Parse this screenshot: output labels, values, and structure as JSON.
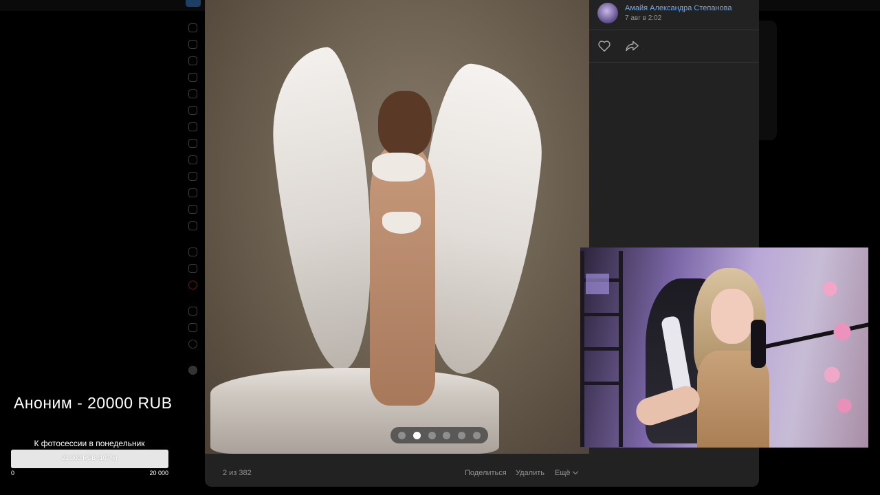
{
  "post": {
    "author_name": "Амайя Александра Степанова",
    "date": "7 авг в 2:02"
  },
  "viewer": {
    "counter": "2 из 382",
    "actions": {
      "share": "Поделиться",
      "delete": "Удалить",
      "more": "Ещё"
    },
    "carousel": {
      "count": 6,
      "active_index": 1
    }
  },
  "donation": {
    "message": "Аноним - 20000 RUB"
  },
  "goal": {
    "title": "К фотосессии в понедельник",
    "progress_text": "21 300 RUB (107%)",
    "min_label": "0",
    "max_label": "20 000",
    "progress_fraction": 1.0
  },
  "colors": {
    "link": "#71aaeb",
    "viewer_bg": "#222222",
    "muted_text": "#939393"
  }
}
